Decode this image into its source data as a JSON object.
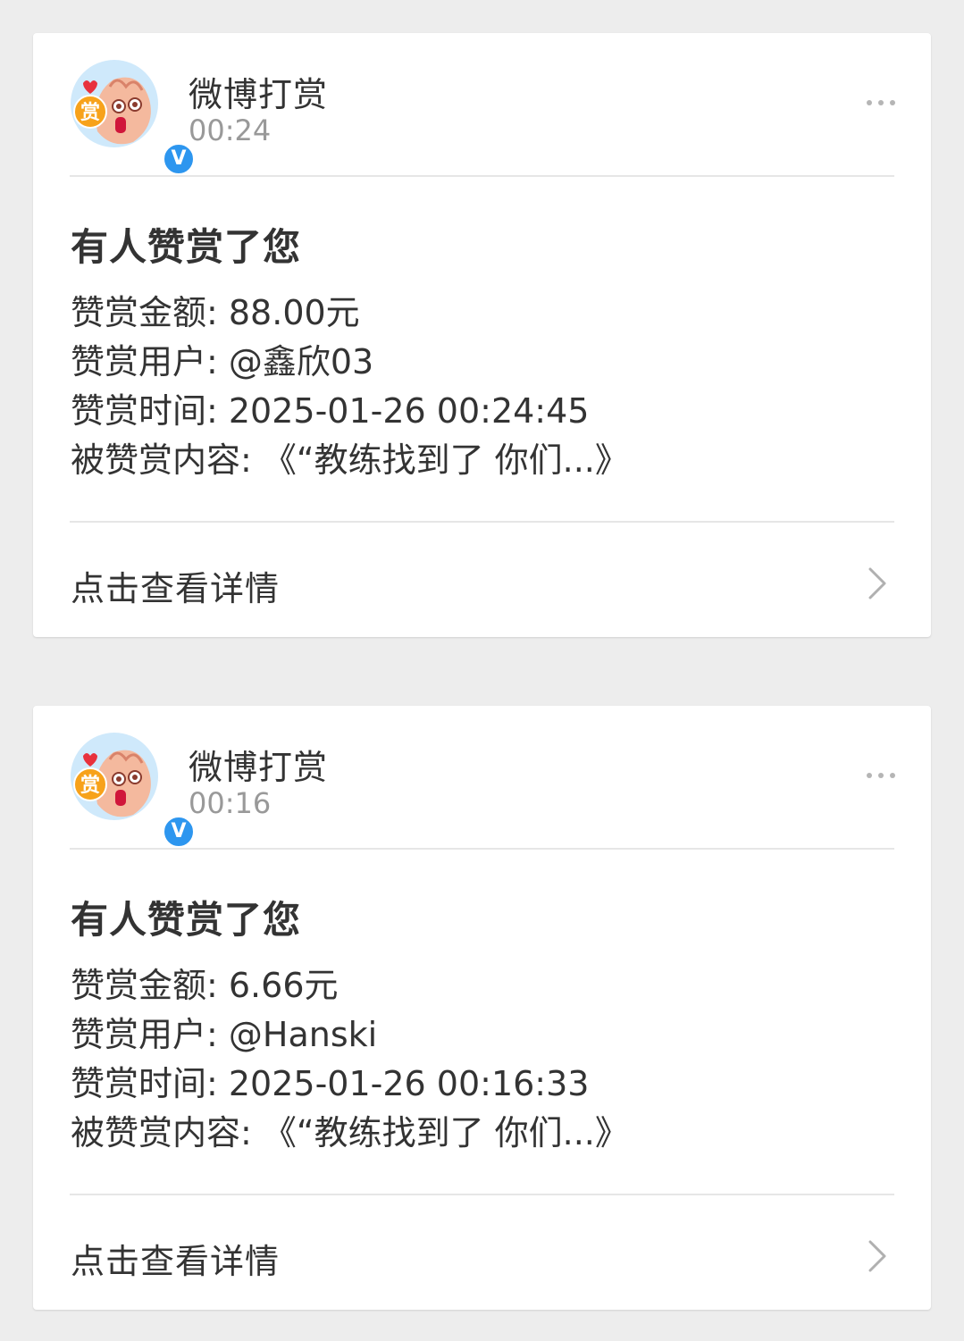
{
  "messages": [
    {
      "sender": "微博打赏",
      "time": "00:24",
      "verified_badge": "V",
      "avatar_text": "赏",
      "title": "有人赞赏了您",
      "rows": [
        "赞赏金额: 88.00元",
        "赞赏用户: @鑫欣03",
        "赞赏时间: 2025-01-26 00:24:45",
        "被赞赏内容: 《“教练找到了 你们...》"
      ],
      "link_label": "点击查看详情"
    },
    {
      "sender": "微博打赏",
      "time": "00:16",
      "verified_badge": "V",
      "avatar_text": "赏",
      "title": "有人赞赏了您",
      "rows": [
        "赞赏金额: 6.66元",
        "赞赏用户: @Hanski",
        "赞赏时间: 2025-01-26 00:16:33",
        "被赞赏内容: 《“教练找到了 你们...》"
      ],
      "link_label": "点击查看详情"
    }
  ],
  "colors": {
    "background": "#ededed",
    "card": "#ffffff",
    "verified": "#2d96ef",
    "primary_text": "#333333",
    "secondary_text": "#999999"
  }
}
